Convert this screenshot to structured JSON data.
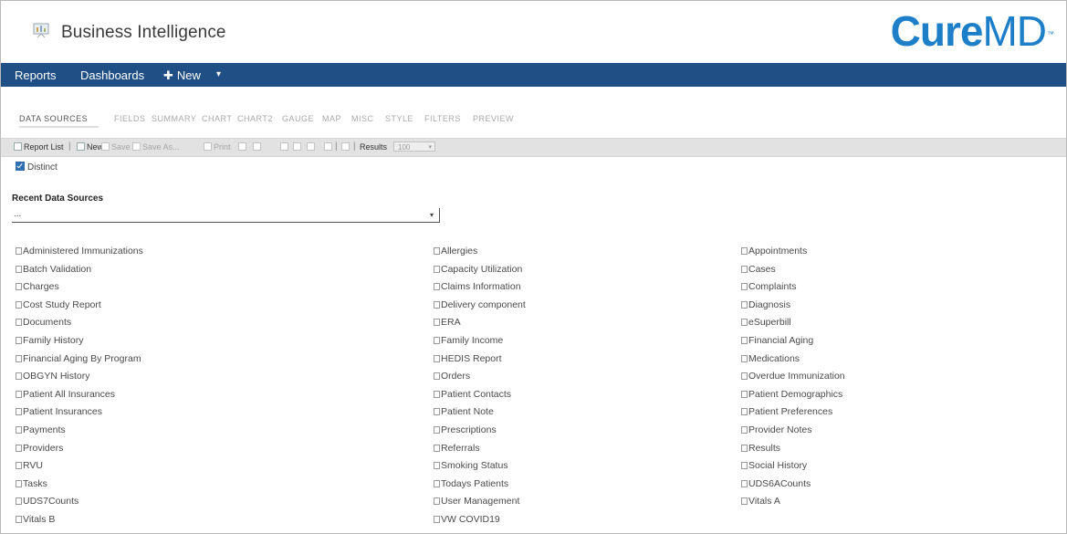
{
  "header": {
    "app_title": "Business Intelligence",
    "brand_bold": "Cure",
    "brand_light": "MD",
    "brand_tm": "™",
    "brand_color": "#1e7fc9",
    "app_icon": "presentation-board-icon"
  },
  "navbar": {
    "bg_color": "#1f4f85",
    "items": [
      "Reports",
      "Dashboards",
      "New"
    ],
    "new_icon": "plus-icon",
    "caret": "▾"
  },
  "tabs": [
    "DATA SOURCES",
    "FIELDS",
    "SUMMARY",
    "CHART",
    "CHART2",
    "GAUGE",
    "MAP",
    "MISC",
    "STYLE",
    "FILTERS",
    "PREVIEW"
  ],
  "active_tab": "DATA SOURCES",
  "toolbar": {
    "report_list": "Report List",
    "new": "New",
    "save": "Save",
    "save_as": "Save As...",
    "print": "Print",
    "results_label": "Results",
    "results_value": "100"
  },
  "distinct": {
    "label": "Distinct",
    "checked": true
  },
  "recent": {
    "title": "Recent Data Sources",
    "selected": "..."
  },
  "data_sources": {
    "col1": [
      "Administered Immunizations",
      "Batch Validation",
      "Charges",
      "Cost Study Report",
      "Documents",
      "Family History",
      "Financial Aging By Program",
      "OBGYN History",
      "Patient All Insurances",
      "Patient Insurances",
      "Payments",
      "Providers",
      "RVU",
      "Tasks",
      "UDS7Counts",
      "Vitals B"
    ],
    "col2": [
      "Allergies",
      "Capacity Utilization",
      "Claims Information",
      "Delivery component",
      "ERA",
      "Family Income",
      "HEDIS Report",
      "Orders",
      "Patient Contacts",
      "Patient Note",
      "Prescriptions",
      "Referrals",
      "Smoking Status",
      "Todays Patients",
      "User Management",
      "VW COVID19"
    ],
    "col3": [
      "Appointments",
      "Cases",
      "Complaints",
      "Diagnosis",
      "eSuperbill",
      "Financial Aging",
      "Medications",
      "Overdue Immunization",
      "Patient Demographics",
      "Patient Preferences",
      "Provider Notes",
      "Results",
      "Social History",
      "UDS6ACounts",
      "Vitals A"
    ]
  }
}
